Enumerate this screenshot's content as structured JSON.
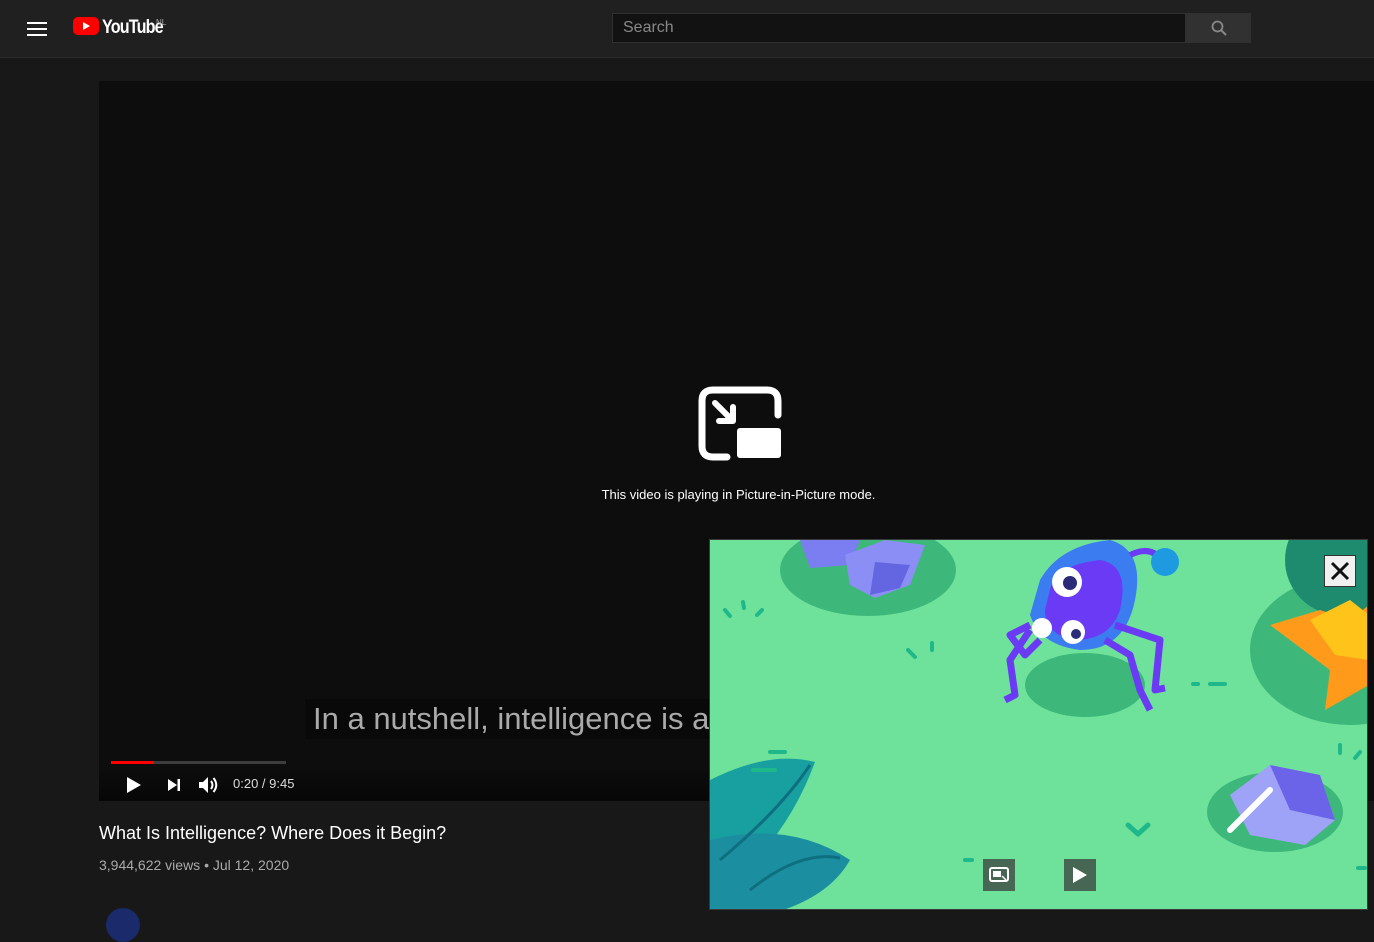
{
  "header": {
    "logo_text": "YouTube",
    "country_code": "NL",
    "search_placeholder": "Search"
  },
  "player": {
    "pip_message": "This video is playing in Picture-in-Picture mode.",
    "caption": "In a nutshell, intelligence is a",
    "time_current": "0:20",
    "time_total": "9:45",
    "time_display": "0:20 / 9:45",
    "progress_fraction": 0.034,
    "accent_color": "#ff0000"
  },
  "video": {
    "title": "What Is Intelligence? Where Does it Begin?",
    "meta": "3,944,622 views • Jul 12, 2020"
  },
  "pip_window": {
    "close_icon": "close-icon",
    "back_to_tab_icon": "back-to-tab-icon",
    "play_icon": "play-icon"
  }
}
